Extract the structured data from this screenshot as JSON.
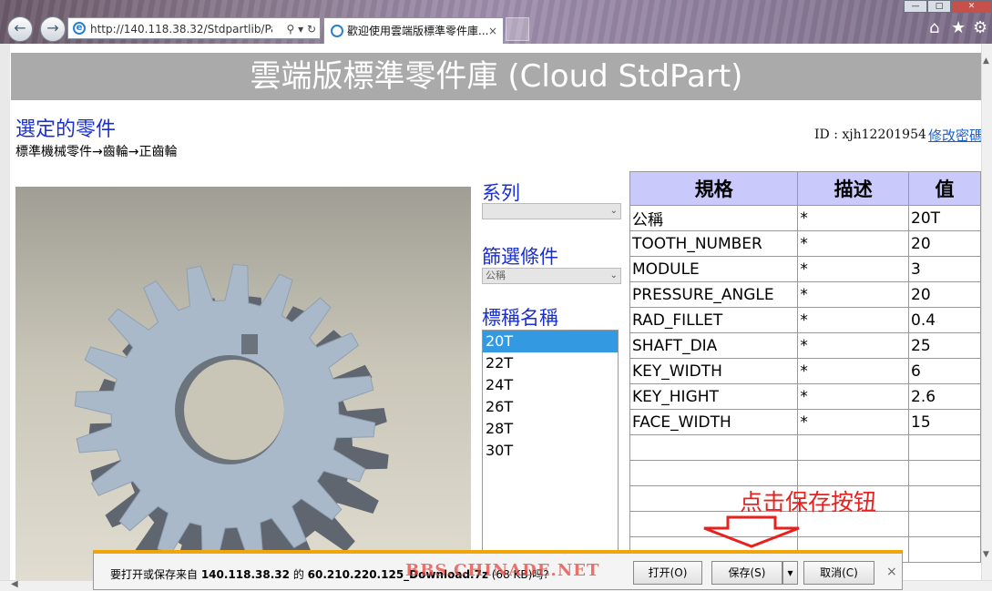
{
  "browser": {
    "url": "http://140.118.38.32/Stdpartlib/Pa",
    "tab_title": "歡迎使用雲端版標準零件庫...",
    "tab_close": "×"
  },
  "page": {
    "banner": "雲端版標準零件庫 (Cloud StdPart)",
    "selected_title": "選定的零件",
    "breadcrumb": "標準機械零件→齒輪→正齒輪",
    "user_id": "ID : xjh12201954",
    "change_password": "修改密碼"
  },
  "filters": {
    "series_label": "系列",
    "series_value": "",
    "condition_label": "篩選條件",
    "condition_value": "公稱",
    "name_label": "標稱名稱",
    "names": [
      "20T",
      "22T",
      "24T",
      "26T",
      "28T",
      "30T"
    ],
    "selected_name": "20T"
  },
  "spec_table": {
    "headers": [
      "規格",
      "描述",
      "值"
    ],
    "rows": [
      [
        "公稱",
        "*",
        "20T"
      ],
      [
        "TOOTH_NUMBER",
        "*",
        "20"
      ],
      [
        "MODULE",
        "*",
        "3"
      ],
      [
        "PRESSURE_ANGLE",
        "*",
        "20"
      ],
      [
        "RAD_FILLET",
        "*",
        "0.4"
      ],
      [
        "SHAFT_DIA",
        "*",
        "25"
      ],
      [
        "KEY_WIDTH",
        "*",
        "6"
      ],
      [
        "KEY_HIGHT",
        "*",
        "2.6"
      ],
      [
        "FACE_WIDTH",
        "*",
        "15"
      ]
    ],
    "empty_rows": 5
  },
  "annotation": "点击保存按钮",
  "download_bar": {
    "msg_prefix": "要打开或保存来自 ",
    "host": "140.118.38.32",
    "msg_mid": " 的 ",
    "file": "60.210.220.125_Download.7z",
    "msg_suffix": " (68 KB)吗?",
    "watermark": "BBS.CHINADE.NET",
    "open": "打开(O)",
    "save": "保存(S)",
    "cancel": "取消(C)",
    "close": "×"
  },
  "colors": {
    "link_blue": "#1a2fd0",
    "header_bg": "#c9c9fb",
    "annotation_red": "#e8201e",
    "download_accent": "#f0a60a",
    "gear": "#a9b9c9"
  }
}
